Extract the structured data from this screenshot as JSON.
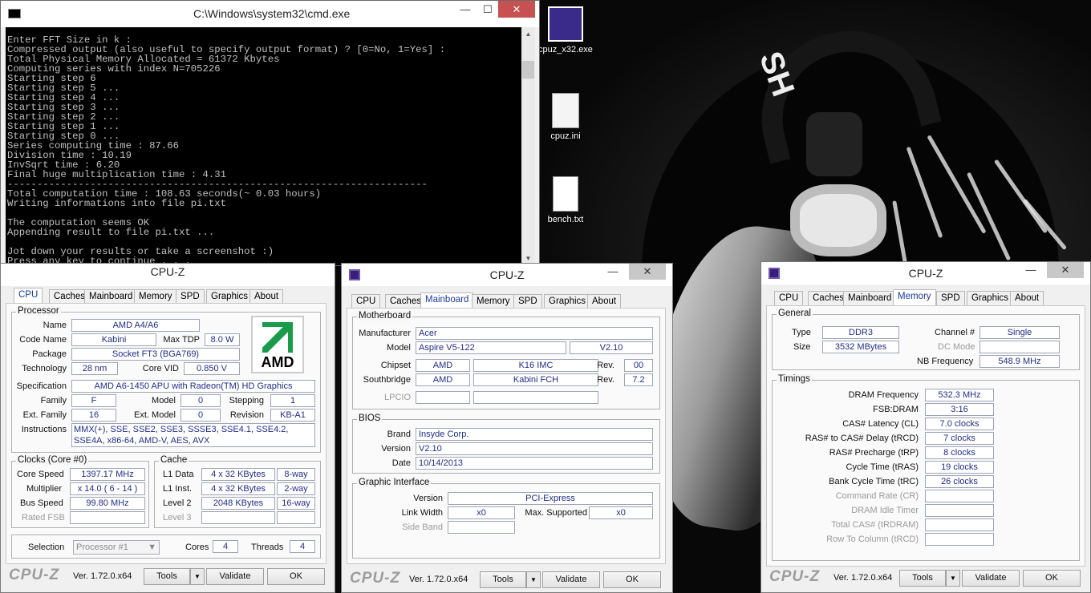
{
  "cmd": {
    "title": "C:\\Windows\\system32\\cmd.exe",
    "lines": [
      "Enter FFT Size in k :",
      "Compressed output (also useful to specify output format) ? [0=No, 1=Yes] :",
      "Total Physical Memory Allocated = 61372 Kbytes",
      "Computing series with index N=705226",
      "Starting step 6",
      "Starting step 5 ...",
      "Starting step 4 ...",
      "Starting step 3 ...",
      "Starting step 2 ...",
      "Starting step 1 ...",
      "Starting step 0 ...",
      "Series computing time : 87.66",
      "Division time : 10.19",
      "InvSqrt time : 6.20",
      "Final huge multiplication time : 4.31",
      "-----------------------------------------------------------------------",
      "Total computation time : 108.63 seconds(~ 0.03 hours)",
      "Writing informations into file pi.txt",
      "",
      "The computation seems OK",
      "Appending result to file pi.txt ...",
      "",
      "Jot down your results or take a screenshot :)",
      "Press any key to continue . . ."
    ],
    "controls": {
      "min": "—",
      "max": "☐",
      "close": "✕"
    }
  },
  "desktop": {
    "icons": [
      "cpuz_x32.exe",
      "cpuz.ini",
      "bench.txt"
    ],
    "band_text": "SH"
  },
  "cpuz1": {
    "title": "CPU-Z",
    "tabs": [
      "CPU",
      "Caches",
      "Mainboard",
      "Memory",
      "SPD",
      "Graphics",
      "About"
    ],
    "processor": {
      "group": "Processor",
      "name_l": "Name",
      "name": "AMD A4/A6",
      "code_l": "Code Name",
      "code": "Kabini",
      "tdp_l": "Max TDP",
      "tdp": "8.0 W",
      "pkg_l": "Package",
      "pkg": "Socket FT3 (BGA769)",
      "tech_l": "Technology",
      "tech": "28 nm",
      "vid_l": "Core VID",
      "vid": "0.850 V",
      "spec_l": "Specification",
      "spec": "AMD A6-1450 APU with Radeon(TM) HD Graphics",
      "fam_l": "Family",
      "fam": "F",
      "model_l": "Model",
      "model": "0",
      "step_l": "Stepping",
      "step": "1",
      "efam_l": "Ext. Family",
      "efam": "16",
      "emod_l": "Ext. Model",
      "emod": "0",
      "rev_l": "Revision",
      "rev": "KB-A1",
      "inst_l": "Instructions",
      "inst": "MMX(+), SSE, SSE2, SSE3, SSSE3, SSE4.1, SSE4.2, SSE4A, x86-64, AMD-V, AES, AVX",
      "logo": "AMD"
    },
    "clocks": {
      "group": "Clocks (Core #0)",
      "cs_l": "Core Speed",
      "cs": "1397.17 MHz",
      "mul_l": "Multiplier",
      "mul": "x 14.0 ( 6 - 14 )",
      "bus_l": "Bus Speed",
      "bus": "99.80 MHz",
      "fsb_l": "Rated FSB"
    },
    "cache": {
      "group": "Cache",
      "l1d_l": "L1 Data",
      "l1d": "4 x 32 KBytes",
      "l1d_w": "8-way",
      "l1i_l": "L1 Inst.",
      "l1i": "4 x 32 KBytes",
      "l1i_w": "2-way",
      "l2_l": "Level 2",
      "l2": "2048 KBytes",
      "l2_w": "16-way",
      "l3_l": "Level 3"
    },
    "sel": {
      "sel_l": "Selection",
      "sel": "Processor #1",
      "cores_l": "Cores",
      "cores": "4",
      "thr_l": "Threads",
      "thr": "4"
    },
    "footer": {
      "logo": "CPU-Z",
      "ver": "Ver. 1.72.0.x64",
      "tools": "Tools",
      "validate": "Validate",
      "ok": "OK"
    }
  },
  "cpuz2": {
    "title": "CPU-Z",
    "tabs": [
      "CPU",
      "Caches",
      "Mainboard",
      "Memory",
      "SPD",
      "Graphics",
      "About"
    ],
    "mb": {
      "group": "Motherboard",
      "man_l": "Manufacturer",
      "man": "Acer",
      "model_l": "Model",
      "model": "Aspire V5-122",
      "model_v": "V2.10",
      "chip_l": "Chipset",
      "chip": "AMD",
      "chip2": "K16 IMC",
      "rev_l": "Rev.",
      "chip_r": "00",
      "sb_l": "Southbridge",
      "sb": "AMD",
      "sb2": "Kabini FCH",
      "sb_r": "7.2",
      "lpc_l": "LPCIO"
    },
    "bios": {
      "group": "BIOS",
      "brand_l": "Brand",
      "brand": "Insyde Corp.",
      "ver_l": "Version",
      "ver": "V2.10",
      "date_l": "Date",
      "date": "10/14/2013"
    },
    "gi": {
      "group": "Graphic Interface",
      "ver_l": "Version",
      "ver": "PCI-Express",
      "lw_l": "Link Width",
      "lw": "x0",
      "ms_l": "Max. Supported",
      "ms": "x0",
      "sb_l": "Side Band"
    },
    "footer": {
      "logo": "CPU-Z",
      "ver": "Ver. 1.72.0.x64",
      "tools": "Tools",
      "validate": "Validate",
      "ok": "OK"
    }
  },
  "cpuz3": {
    "title": "CPU-Z",
    "tabs": [
      "CPU",
      "Caches",
      "Mainboard",
      "Memory",
      "SPD",
      "Graphics",
      "About"
    ],
    "gen": {
      "group": "General",
      "type_l": "Type",
      "type": "DDR3",
      "ch_l": "Channel #",
      "ch": "Single",
      "size_l": "Size",
      "size": "3532 MBytes",
      "dc_l": "DC Mode",
      "nb_l": "NB Frequency",
      "nb": "548.9 MHz"
    },
    "tim": {
      "group": "Timings",
      "rows": [
        {
          "l": "DRAM Frequency",
          "v": "532.3 MHz"
        },
        {
          "l": "FSB:DRAM",
          "v": "3:16"
        },
        {
          "l": "CAS# Latency (CL)",
          "v": "7.0 clocks"
        },
        {
          "l": "RAS# to CAS# Delay (tRCD)",
          "v": "7 clocks"
        },
        {
          "l": "RAS# Precharge (tRP)",
          "v": "8 clocks"
        },
        {
          "l": "Cycle Time (tRAS)",
          "v": "19 clocks"
        },
        {
          "l": "Bank Cycle Time (tRC)",
          "v": "26 clocks"
        },
        {
          "l": "Command Rate (CR)",
          "v": ""
        },
        {
          "l": "DRAM Idle Timer",
          "v": ""
        },
        {
          "l": "Total CAS# (tRDRAM)",
          "v": ""
        },
        {
          "l": "Row To Column (tRCD)",
          "v": ""
        }
      ]
    },
    "footer": {
      "logo": "CPU-Z",
      "ver": "Ver. 1.72.0.x64",
      "tools": "Tools",
      "validate": "Validate",
      "ok": "OK"
    }
  }
}
